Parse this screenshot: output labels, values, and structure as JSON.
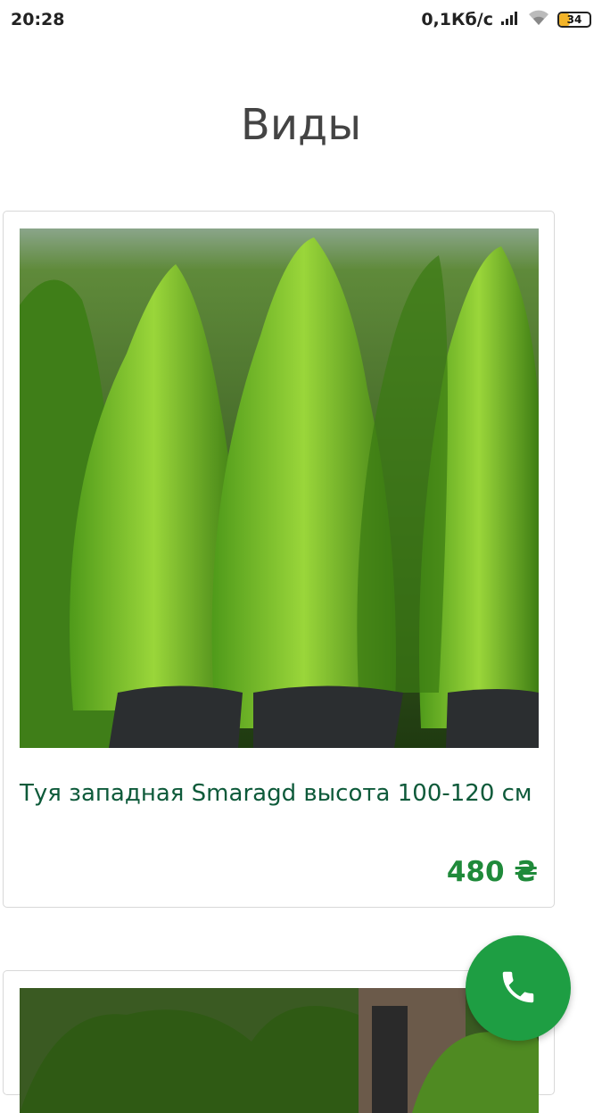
{
  "status_bar": {
    "time": "20:28",
    "network_speed": "0,1Кб/с",
    "battery": "34",
    "battery_level": 0.34,
    "signal_icon": "signal-icon",
    "wifi_icon": "wifi-icon"
  },
  "page": {
    "title": "Виды"
  },
  "products": [
    {
      "name": "Туя западная Smaragd высота 100-120 см",
      "price": "480 ₴",
      "image": "thuja-smaragd-photo"
    },
    {
      "image": "thuja-photo-2"
    }
  ],
  "fab": {
    "icon": "phone-icon",
    "color": "#1e9e43"
  },
  "colors": {
    "product_name": "#0e5a3a",
    "price": "#1f8a3a"
  }
}
